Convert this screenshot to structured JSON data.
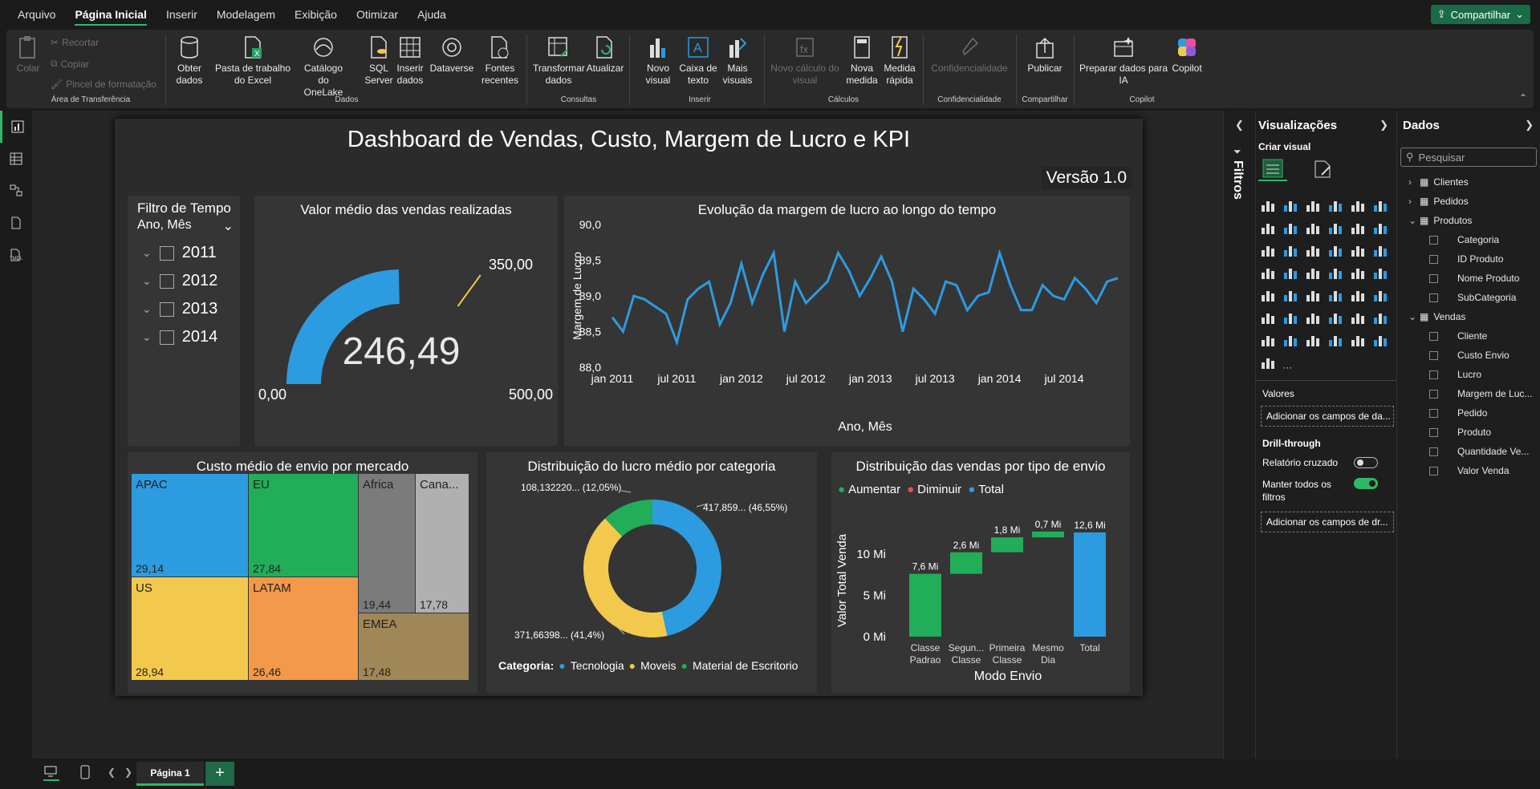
{
  "menu": {
    "items": [
      "Arquivo",
      "Página Inicial",
      "Inserir",
      "Modelagem",
      "Exibição",
      "Otimizar",
      "Ajuda"
    ],
    "share": "Compartilhar"
  },
  "ribbon": {
    "clipboard": {
      "paste": "Colar",
      "cut": "Recortar",
      "copy": "Copiar",
      "format": "Pincel de formatação",
      "group": "Área de Transferência"
    },
    "data": {
      "get": "Obter dados",
      "excel": "Pasta de trabalho do Excel",
      "onelake": "Catálogo do OneLake",
      "sql": "SQL Server",
      "enter": "Inserir dados",
      "dataverse": "Dataverse",
      "recent": "Fontes recentes",
      "group": "Dados"
    },
    "queries": {
      "transform": "Transformar dados",
      "refresh": "Atualizar",
      "group": "Consultas"
    },
    "insert": {
      "visual": "Novo visual",
      "text": "Caixa de texto",
      "more": "Mais visuais",
      "group": "Inserir"
    },
    "calc": {
      "newcalc": "Novo cálculo do visual",
      "measure": "Nova medida",
      "quick": "Medida rápida",
      "group": "Cálculos"
    },
    "sens": {
      "label": "Confidencialidade",
      "group": "Confidencialidade"
    },
    "share": {
      "publish": "Publicar",
      "group": "Compartilhar"
    },
    "copilot": {
      "prep": "Preparar dados para IA",
      "copilot": "Copilot",
      "group": "Copilot"
    }
  },
  "report": {
    "title": "Dashboard de Vendas, Custo, Margem de Lucro e KPI",
    "version": "Versão 1.0"
  },
  "slicer": {
    "title": "Filtro de Tempo",
    "sub": "Ano, Mês",
    "years": [
      "2011",
      "2012",
      "2013",
      "2014"
    ]
  },
  "gauge": {
    "title": "Valor médio das vendas realizadas",
    "value": "246,49",
    "min": "0,00",
    "max": "500,00",
    "target": "350,00",
    "fraction": 0.493
  },
  "line": {
    "title": "Evolução da margem de lucro ao longo do tempo",
    "ylabel": "Margem de Lucro",
    "xlabel": "Ano, Mês",
    "yticks": [
      "90,0",
      "89,5",
      "89,0",
      "88,5",
      "88,0"
    ],
    "xticks": [
      "jan 2011",
      "jul 2011",
      "jan 2012",
      "jul 2012",
      "jan 2013",
      "jul 2013",
      "jan 2014",
      "jul 2014"
    ],
    "values": [
      88.7,
      88.5,
      89.0,
      88.95,
      88.85,
      88.75,
      88.35,
      88.95,
      89.1,
      89.2,
      88.6,
      88.9,
      89.45,
      88.9,
      89.3,
      89.6,
      88.5,
      89.2,
      88.9,
      89.05,
      89.2,
      89.6,
      89.35,
      89.0,
      89.25,
      89.55,
      89.2,
      88.5,
      89.1,
      88.95,
      88.75,
      89.2,
      89.15,
      88.8,
      89.0,
      89.05,
      89.6,
      89.15,
      88.8,
      88.8,
      89.15,
      89.0,
      88.95,
      89.25,
      89.1,
      88.9,
      89.2,
      89.25
    ]
  },
  "treemap": {
    "title": "Custo médio de envio por mercado",
    "items": [
      {
        "name": "APAC",
        "value": "29,14",
        "color": "#2d9be0"
      },
      {
        "name": "EU",
        "value": "27,84",
        "color": "#22ad59"
      },
      {
        "name": "Africa",
        "value": "19,44",
        "color": "#7b7b7b"
      },
      {
        "name": "Cana...",
        "value": "17,78",
        "color": "#b0b0b0"
      },
      {
        "name": "US",
        "value": "28,94",
        "color": "#f2c94c"
      },
      {
        "name": "LATAM",
        "value": "26,46",
        "color": "#f2994a"
      },
      {
        "name": "EMEA",
        "value": "17,48",
        "color": "#a08757"
      }
    ]
  },
  "donut": {
    "title": "Distribuição do lucro médio por categoria",
    "legend_title": "Categoria:",
    "slices": [
      {
        "name": "Tecnologia",
        "pct": 46.55,
        "label": "417,859... (46,55%)",
        "color": "#2d9be0"
      },
      {
        "name": "Moveis",
        "pct": 41.4,
        "label": "371,66398... (41,4%)",
        "color": "#f2c94c"
      },
      {
        "name": "Material de Escritorio",
        "pct": 12.05,
        "label": "108,132220... (12,05%)",
        "color": "#22ad59"
      }
    ]
  },
  "waterfall": {
    "title": "Distribuição das vendas por tipo de envio",
    "ylabel": "Valor Total Venda",
    "xlabel": "Modo Envio",
    "legend": [
      {
        "name": "Aumentar",
        "color": "#22ad59"
      },
      {
        "name": "Diminuir",
        "color": "#e94f4f"
      },
      {
        "name": "Total",
        "color": "#2d9be0"
      }
    ],
    "yticks": [
      "10 Mi",
      "5 Mi",
      "0 Mi"
    ],
    "bars": [
      {
        "cat": "Classe Padrao",
        "value": 7.6,
        "label": "7,6 Mi"
      },
      {
        "cat": "Segun... Classe",
        "value": 2.6,
        "label": "2,6 Mi"
      },
      {
        "cat": "Primeira Classe",
        "value": 1.8,
        "label": "1,8 Mi"
      },
      {
        "cat": "Mesmo Dia",
        "value": 0.7,
        "label": "0,7 Mi"
      },
      {
        "cat": "Total",
        "value": 12.6,
        "label": "12,6 Mi",
        "total": true
      }
    ]
  },
  "filters": {
    "label": "Filtros"
  },
  "viz": {
    "title": "Visualizações",
    "create": "Criar visual",
    "values": "Valores",
    "add": "Adicionar os campos de da...",
    "drill": "Drill-through",
    "cross": "Relatório cruzado",
    "keep": "Manter todos os filtros",
    "add2": "Adicionar os campos de dr..."
  },
  "dados": {
    "title": "Dados",
    "search": "Pesquisar",
    "tables": [
      {
        "name": "Clientes",
        "expanded": false,
        "fields": []
      },
      {
        "name": "Pedidos",
        "expanded": false,
        "fields": []
      },
      {
        "name": "Produtos",
        "expanded": true,
        "fields": [
          "Categoria",
          "ID Produto",
          "Nome Produto",
          "SubCategoria"
        ]
      },
      {
        "name": "Vendas",
        "expanded": true,
        "fields": [
          "Cliente",
          "Custo Envio",
          "Lucro",
          "Margem de Luc...",
          "Pedido",
          "Produto",
          "Quantidade Ve...",
          "Valor Venda"
        ]
      }
    ]
  },
  "pages": {
    "current": "Página 1"
  }
}
